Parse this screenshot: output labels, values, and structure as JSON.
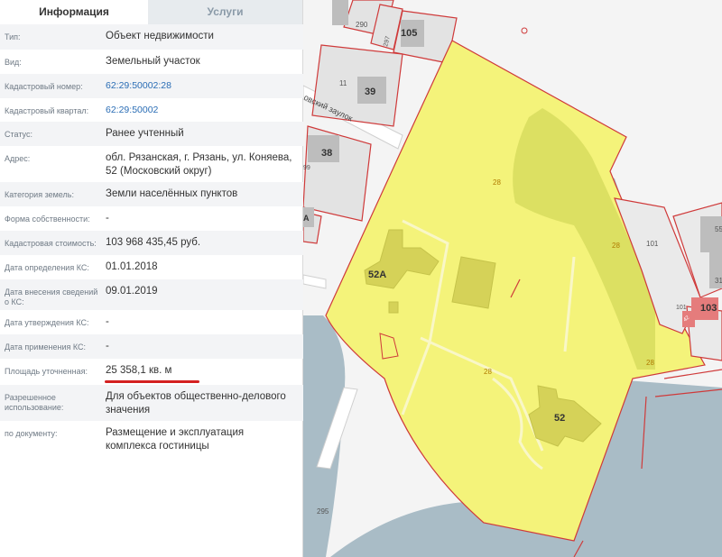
{
  "tabs": {
    "info": "Информация",
    "services": "Услуги"
  },
  "fields": [
    {
      "label": "Тип:",
      "value": "Объект недвижимости"
    },
    {
      "label": "Вид:",
      "value": "Земельный участок"
    },
    {
      "label": "Кадастровый номер:",
      "value": "62:29:50002:28",
      "link": true
    },
    {
      "label": "Кадастровый квартал:",
      "value": "62:29:50002",
      "link": true
    },
    {
      "label": "Статус:",
      "value": "Ранее учтенный"
    },
    {
      "label": "Адрес:",
      "value": "обл. Рязанская, г. Рязань, ул. Коняева, 52 (Московский округ)"
    },
    {
      "label": "Категория земель:",
      "value": "Земли населённых пунктов"
    },
    {
      "label": "Форма собственности:",
      "value": "-"
    },
    {
      "label": "Кадастровая стоимость:",
      "value": "103 968 435,45 руб."
    },
    {
      "label": "Дата определения КС:",
      "value": "01.01.2018"
    },
    {
      "label": "Дата внесения сведений о КС:",
      "value": "09.01.2019"
    },
    {
      "label": "Дата утверждения КС:",
      "value": "-"
    },
    {
      "label": "Дата применения КС:",
      "value": "-"
    },
    {
      "label": "Площадь уточненная:",
      "value": "25 358,1 кв. м"
    },
    {
      "label": "Разрешенное использование:",
      "value": "Для объектов общественно-делового значения"
    },
    {
      "label": "по документу:",
      "value": "Размещение и эксплуатация комплекса гостиницы"
    }
  ],
  "map": {
    "parcel_color": "#f4f37a",
    "parcel_border": "#cf3a3a",
    "water_color": "#a9bcc6",
    "street_name": "овский заулок",
    "labels": {
      "b290": "290",
      "b297": "297",
      "b105": "105",
      "b11": "11",
      "b39": "39",
      "b38": "38",
      "b99": "99",
      "bA": "А",
      "p28a": "28",
      "p28b": "28",
      "p28c": "28",
      "p28d": "28",
      "p28e": "28",
      "b52A": "52А",
      "b52": "52",
      "b101a": "101",
      "b101b": "101",
      "b103": "103",
      "b55": "55",
      "b31": "31",
      "b295": "295",
      "b42": "42"
    }
  }
}
